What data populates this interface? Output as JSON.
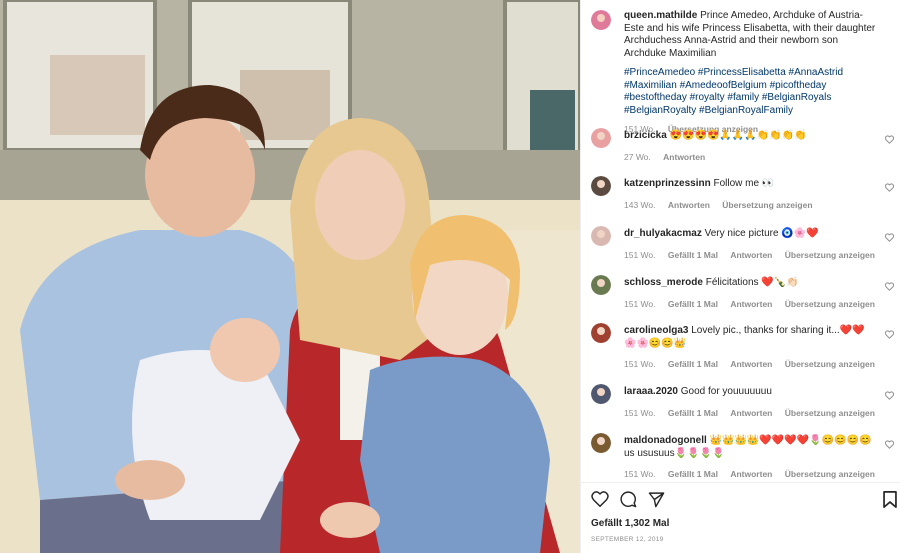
{
  "post": {
    "username": "queen.mathilde",
    "caption": "Prince Amedeo, Archduke of Austria-Este and his wife Princess Elisabetta, with their daughter Archduchess Anna-Astrid and their newborn son Archduke Maximilian",
    "hashtags": "#PrinceAmedeo #PrincessElisabetta #AnnaAstrid #Maximilian #AmedeoofBelgium #picoftheday #bestoftheday #royalty #family #BelgianRoyals #BelgianRoyalty #BelgianRoyalFamily",
    "time": "151 Wo.",
    "translate": "Übersetzung anzeigen",
    "likes": "Gefällt 1,302 Mal",
    "date": "SEPTEMBER 12, 2019"
  },
  "comments": [
    {
      "username": "brzicicka",
      "text": "😍😍😍😍🙏🙏🙏👏👏👏👏",
      "time": "27 Wo.",
      "likes": "",
      "reply": "Antworten",
      "translate": "",
      "avatar_color": "#e8a0a0"
    },
    {
      "username": "katzenprinzessinn",
      "text": "Follow me 👀",
      "time": "143 Wo.",
      "likes": "",
      "reply": "Antworten",
      "translate": "Übersetzung anzeigen",
      "avatar_color": "#5a4a40"
    },
    {
      "username": "dr_hulyakacmaz",
      "text": "Very nice picture 🧿🌸❤️",
      "time": "151 Wo.",
      "likes": "Gefällt 1 Mal",
      "reply": "Antworten",
      "translate": "Übersetzung anzeigen",
      "avatar_color": "#d8b8b0"
    },
    {
      "username": "schloss_merode",
      "text": "Félicitations ❤️🍾👏🏻",
      "time": "151 Wo.",
      "likes": "Gefällt 1 Mal",
      "reply": "Antworten",
      "translate": "Übersetzung anzeigen",
      "avatar_color": "#6a7a50"
    },
    {
      "username": "carolineolga3",
      "text": "Lovely pic., thanks for sharing it...❤️❤️🌸🌸😊😊👑",
      "time": "151 Wo.",
      "likes": "Gefällt 1 Mal",
      "reply": "Antworten",
      "translate": "Übersetzung anzeigen",
      "avatar_color": "#a04030"
    },
    {
      "username": "laraaa.2020",
      "text": "Good for youuuuuuu",
      "time": "151 Wo.",
      "likes": "Gefällt 1 Mal",
      "reply": "Antworten",
      "translate": "Übersetzung anzeigen",
      "avatar_color": "#505870"
    },
    {
      "username": "maldonadogonell",
      "text": "👑👑👑👑❤️❤️❤️❤️🌷😊😊😊😊us ususuus🌷🌷🌷🌷",
      "time": "151 Wo.",
      "likes": "Gefällt 1 Mal",
      "reply": "Antworten",
      "translate": "Übersetzung anzeigen",
      "avatar_color": "#7a5a30"
    }
  ],
  "icons": {
    "like": "heart-icon",
    "comment": "comment-icon",
    "share": "share-icon",
    "save": "bookmark-icon"
  },
  "colors": {
    "hashtag": "#00376b",
    "meta": "#8e8e8e",
    "text": "#262626"
  }
}
